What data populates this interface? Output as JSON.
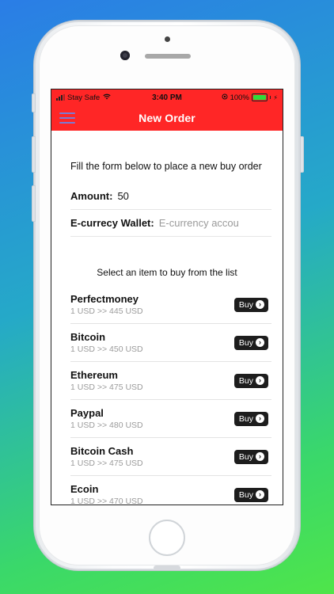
{
  "status_bar": {
    "carrier": "Stay Safe",
    "time": "3:40 PM",
    "battery": "100%"
  },
  "nav": {
    "title": "New Order"
  },
  "form": {
    "intro": "Fill the form below to place a new buy order",
    "amount_label": "Amount:",
    "amount_value": "50",
    "wallet_label": "E-currecy Wallet:",
    "wallet_placeholder": "E-currency accou"
  },
  "list": {
    "title": "Select an item to buy from the list",
    "buy_label": "Buy",
    "items": [
      {
        "name": "Perfectmoney",
        "rate": "1 USD >> 445 USD"
      },
      {
        "name": "Bitcoin",
        "rate": "1 USD >> 450 USD"
      },
      {
        "name": "Ethereum",
        "rate": "1 USD >> 475 USD"
      },
      {
        "name": "Paypal",
        "rate": "1 USD >> 480 USD"
      },
      {
        "name": "Bitcoin Cash",
        "rate": "1 USD >> 475 USD"
      },
      {
        "name": "Ecoin",
        "rate": "1 USD >> 470 USD"
      }
    ]
  },
  "colors": {
    "header": "#ff2626",
    "buy_button": "#1d1d1d",
    "menu_icon": "#7b7bd4"
  }
}
